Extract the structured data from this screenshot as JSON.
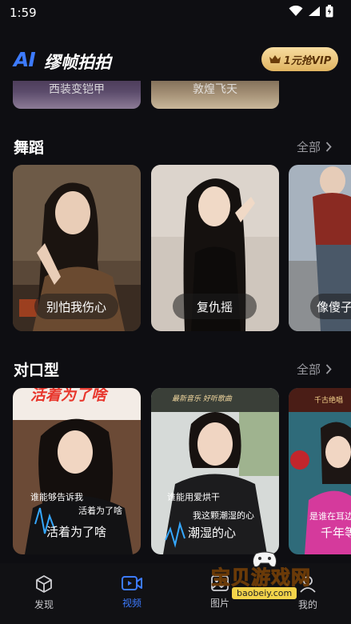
{
  "status": {
    "time": "1:59"
  },
  "header": {
    "logo_mark": "AI",
    "app_name": "缪帧拍拍",
    "vip_label": "1元抢VIP"
  },
  "partial_row": {
    "cards": [
      {
        "title": "西装变铠甲"
      },
      {
        "title": "敦煌飞天"
      }
    ]
  },
  "sections": [
    {
      "title": "舞蹈",
      "more_label": "全部",
      "cards": [
        {
          "title": "别怕我伤心"
        },
        {
          "title": "复仇摇"
        },
        {
          "title": "像傻子"
        }
      ]
    },
    {
      "title": "对口型",
      "more_label": "全部",
      "cards": [
        {
          "title": "活着为了啥",
          "overlay_top": "活着为了啥",
          "sub1": "谁能够告诉我",
          "sub2": "活着为了啥"
        },
        {
          "title": "潮湿的心",
          "overlay_top": "最新音乐 好听歌曲",
          "sub1": "谁能用爱烘干",
          "sub2": "我这颗潮湿的心"
        },
        {
          "title": "千年等",
          "overlay_top": "千古绝唱",
          "sub1": "是谁在耳边"
        }
      ]
    }
  ],
  "bottom_nav": [
    {
      "label": "发现",
      "icon": "cube-icon"
    },
    {
      "label": "视频",
      "icon": "video-icon"
    },
    {
      "label": "图片",
      "icon": "image-icon"
    },
    {
      "label": "我的",
      "icon": "user-icon"
    }
  ],
  "watermark": {
    "title": "宝贝游戏网",
    "url": "baobeiy.com"
  },
  "colors": {
    "accent": "#3d7bff",
    "background": "#0e0e12",
    "vip_gold": "#e9c47a"
  }
}
